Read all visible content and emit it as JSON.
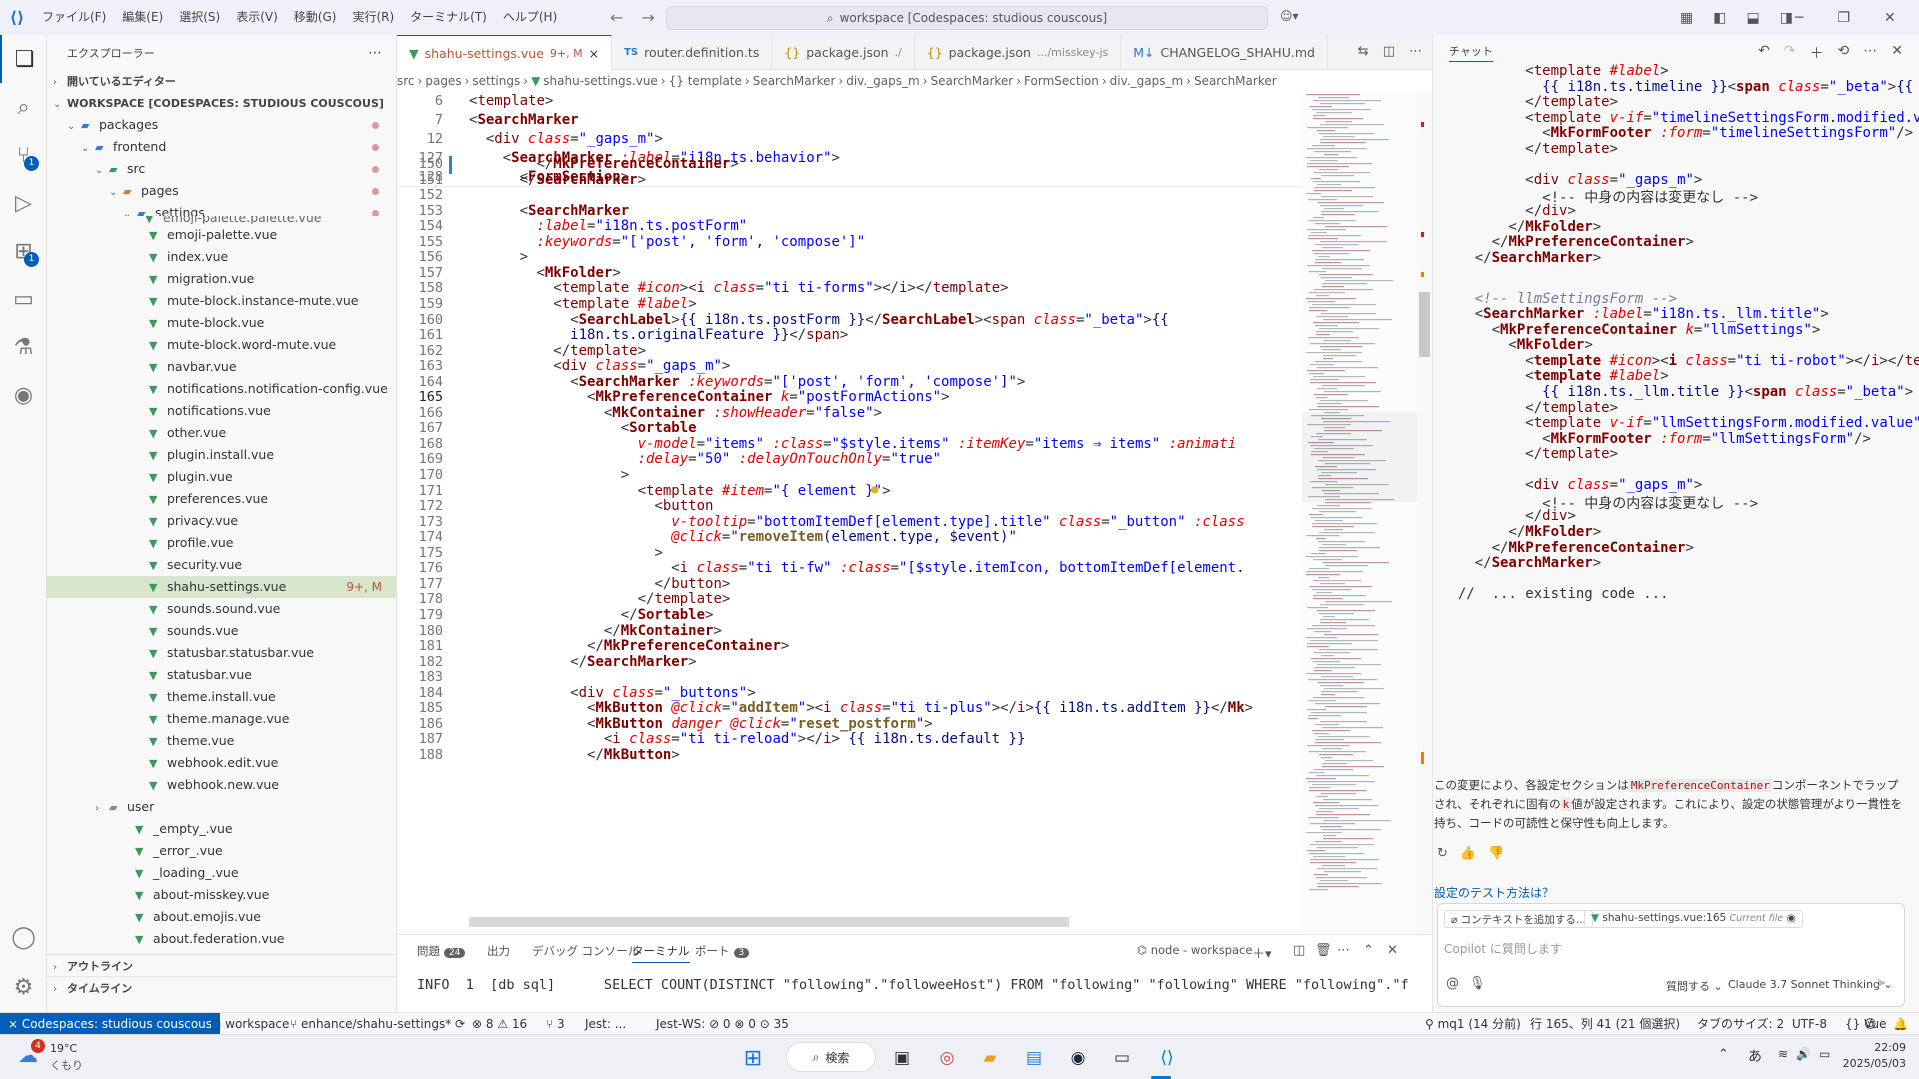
{
  "titlebar": {
    "menu": [
      "ファイル(F)",
      "編集(E)",
      "選択(S)",
      "表示(V)",
      "移動(G)",
      "実行(R)",
      "ターミナル(T)",
      "ヘルプ(H)"
    ],
    "search": "workspace [Codespaces: studious couscous]"
  },
  "activity": {
    "scm_badge": "1",
    "ext_badge": "1"
  },
  "sidebar": {
    "title": "エクスプローラー",
    "open_editors": "開いているエディター",
    "workspace": "WORKSPACE [CODESPACES: STUDIOUS COUSCOUS]",
    "folders": [
      "packages",
      "frontend",
      "src",
      "pages",
      "settings"
    ],
    "clipped_file": "emoji-palette.palette.vue",
    "files": [
      "emoji-palette.vue",
      "index.vue",
      "migration.vue",
      "mute-block.instance-mute.vue",
      "mute-block.vue",
      "mute-block.word-mute.vue",
      "navbar.vue",
      "notifications.notification-config.vue",
      "notifications.vue",
      "other.vue",
      "plugin.install.vue",
      "plugin.vue",
      "preferences.vue",
      "privacy.vue",
      "profile.vue",
      "security.vue",
      "shahu-settings.vue",
      "sounds.sound.vue",
      "sounds.vue",
      "statusbar.statusbar.vue",
      "statusbar.vue",
      "theme.install.vue",
      "theme.manage.vue",
      "theme.vue",
      "webhook.edit.vue",
      "webhook.new.vue"
    ],
    "selected_status": "9+, M",
    "user_folder": "user",
    "page_files": [
      "_empty_.vue",
      "_error_.vue",
      "_loading_.vue",
      "about-misskey.vue",
      "about.emojis.vue",
      "about.federation.vue"
    ],
    "outline": "アウトライン",
    "timeline": "タイムライン"
  },
  "tabs": [
    {
      "label": "shahu-settings.vue",
      "status": "9+, M",
      "close": "×"
    },
    {
      "label": "router.definition.ts",
      "path": ""
    },
    {
      "label": "package.json",
      "path": "./"
    },
    {
      "label": "package.json",
      "path": ".../misskey-js"
    },
    {
      "label": "CHANGELOG_SHAHU.md",
      "path": ""
    }
  ],
  "breadcrumb": [
    "src",
    "pages",
    "settings",
    "shahu-settings.vue",
    "{} template",
    "SearchMarker",
    "div._gaps_m",
    "SearchMarker",
    "FormSection",
    "div._gaps_m",
    "SearchMarker"
  ],
  "editor": {
    "sticky_lines": [
      6,
      7,
      12,
      127,
      128
    ],
    "lines": [
      150,
      151,
      152,
      153,
      154,
      155,
      156,
      157,
      158,
      159,
      160,
      161,
      162,
      163,
      164,
      165,
      166,
      167,
      168,
      169,
      170,
      171,
      172,
      173,
      174,
      175,
      176,
      177,
      178,
      179,
      180,
      181,
      182,
      183,
      184,
      185,
      186,
      187,
      188
    ],
    "current_line": 165
  },
  "panel": {
    "tabs": [
      {
        "label": "問題",
        "badge": "24"
      },
      {
        "label": "出力"
      },
      {
        "label": "デバッグ コンソール"
      },
      {
        "label": "ターミナル"
      },
      {
        "label": "ポート",
        "badge": "3"
      }
    ],
    "terminal_name": "node - workspace",
    "term_line": "INFO  1  [db sql]      SELECT COUNT(DISTINCT \"following\".\"followeeHost\") FROM \"following\" \"following\" WHERE \"following\".\"f"
  },
  "chat": {
    "title": "チャット",
    "comment": "<!-- llmSettingsForm -->",
    "existing": "//  ... existing code ...",
    "message_pre": "この変更により、各設定セクションは",
    "message_code": "MkPreferenceContainer",
    "message_mid": "コンポーネントでラップされ、それぞれに固有の",
    "message_code2": "k",
    "message_post": "値が設定されます。これにより、設定の状態管理がより一貫性を持ち、コードの可読性と保守性も向上します。",
    "suggestion": "設定のテスト方法は？",
    "add_context": "コンテキストを追加する...",
    "current_file": "shahu-settings.vue:165",
    "current_file_label": "Current file",
    "placeholder": "Copilot に質問します",
    "mode": "質問する",
    "model": "Claude 3.7 Sonnet Thinking"
  },
  "status": {
    "remote": "Codespaces: studious couscous",
    "workspace": "workspace",
    "branch": "enhance/shahu-settings*",
    "problems": "⊗ 8 ⚠ 16",
    "ports": "3",
    "jest": "Jest: ...",
    "jestws": "Jest-WS: ⊘ 0 ⊗ 0 ⊙ 35",
    "user": "mq1 (14 分前)",
    "position": "行 165、列 41 (21 個選択)",
    "tab": "タブのサイズ: 2",
    "encoding": "UTF-8",
    "lang": "Vue"
  },
  "taskbar": {
    "weather_badge": "4",
    "temp": "19°C",
    "cond": "くもり",
    "search": "検索",
    "ime": "あ",
    "time": "22:09",
    "date": "2025/05/03"
  },
  "colors": {
    "accent": "#005fb8",
    "selected_row": "#d8e5cc",
    "tag": "#800000",
    "attr": "#e50000",
    "string": "#0000ff"
  }
}
